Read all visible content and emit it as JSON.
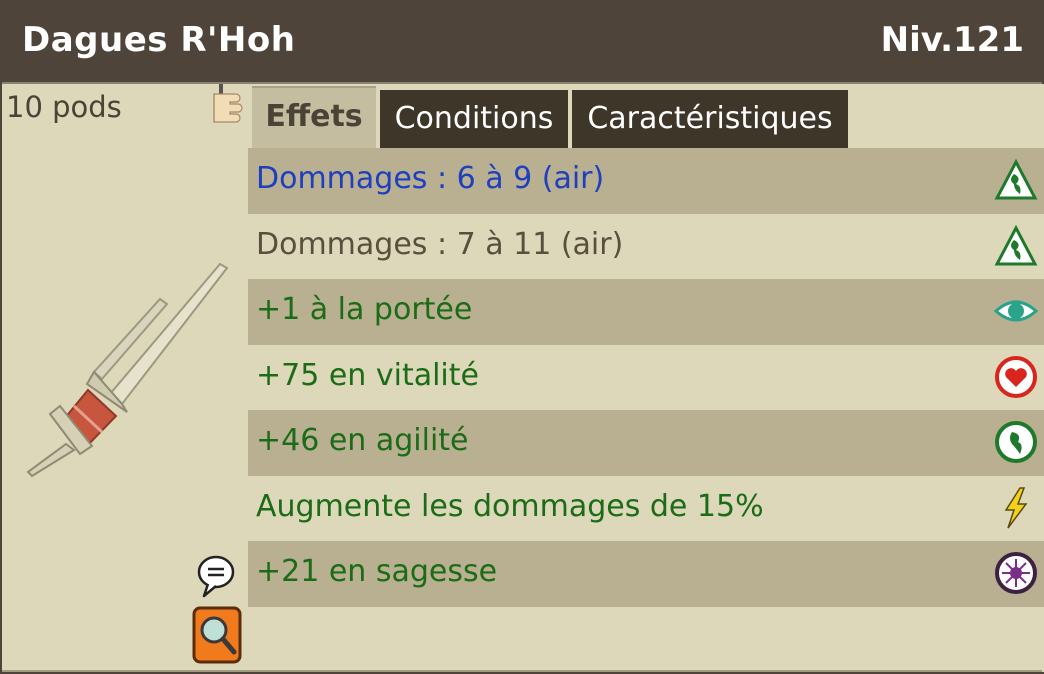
{
  "item": {
    "name": "Dagues R'Hoh",
    "level": "Niv.121",
    "weight": "10 pods"
  },
  "tabs": [
    {
      "label": "Effets",
      "active": true
    },
    {
      "label": "Conditions",
      "active": false
    },
    {
      "label": "Caractéristiques",
      "active": false
    }
  ],
  "effects": [
    {
      "text": "Dommages : 6 à 9 (air)",
      "color": "#1f3fbf",
      "icon": "air-damage-icon"
    },
    {
      "text": "Dommages : 7 à 11 (air)",
      "color": "#5a4f3f",
      "icon": "air-damage-icon"
    },
    {
      "text": "+1 à la portée",
      "color": "#1c6b16",
      "icon": "range-eye-icon"
    },
    {
      "text": "+75 en vitalité",
      "color": "#1c6b16",
      "icon": "vitality-heart-icon"
    },
    {
      "text": "+46 en agilité",
      "color": "#1c6b16",
      "icon": "agility-icon"
    },
    {
      "text": "Augmente les dommages de 15%",
      "color": "#1c6b16",
      "icon": "damage-lightning-icon"
    },
    {
      "text": "+21 en sagesse",
      "color": "#1c6b16",
      "icon": "wisdom-icon"
    }
  ],
  "colors": {
    "header_bg": "#4e4439",
    "panel_bg": "#ddd8ba",
    "row_dark": "#b8b091",
    "tab_dark": "#3d3629",
    "bonus_green": "#1c6b16",
    "base_blue": "#1f3fbf"
  }
}
